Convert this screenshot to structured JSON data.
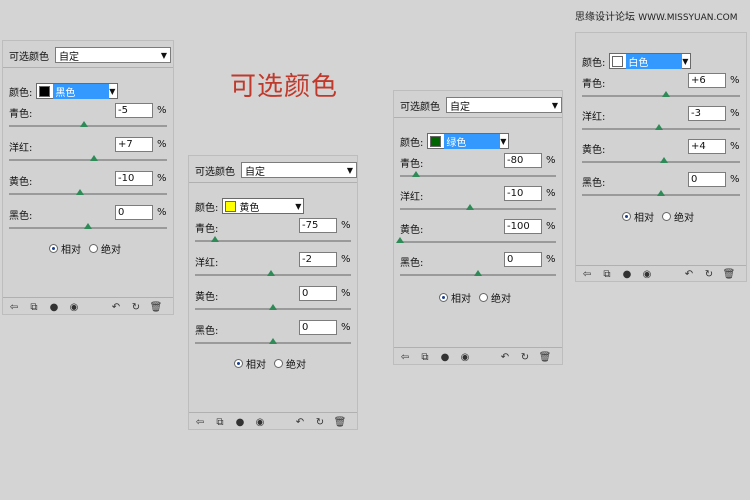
{
  "watermark": {
    "text": "思缘设计论坛",
    "site": "WWW.MISSYUAN.COM"
  },
  "big_title": "可选颜色",
  "common": {
    "header_label": "可选颜色",
    "preset": "自定",
    "color_label": "颜色:",
    "pct": "%",
    "mode_relative": "相对",
    "mode_absolute": "绝对"
  },
  "panels": [
    {
      "id": "black",
      "color": {
        "name": "黑色",
        "swatch": "#000000",
        "selected": true
      },
      "sliders": [
        {
          "label": "青色:",
          "value": "-5",
          "fraction": 0.475
        },
        {
          "label": "洋红:",
          "value": "+7",
          "fraction": 0.535
        },
        {
          "label": "黄色:",
          "value": "-10",
          "fraction": 0.45
        },
        {
          "label": "黑色:",
          "value": "0",
          "fraction": 0.5
        }
      ],
      "mode": "relative"
    },
    {
      "id": "yellow",
      "color": {
        "name": "黄色",
        "swatch": "#ffff00",
        "selected": false
      },
      "sliders": [
        {
          "label": "青色:",
          "value": "-75",
          "fraction": 0.125
        },
        {
          "label": "洋红:",
          "value": "-2",
          "fraction": 0.49
        },
        {
          "label": "黄色:",
          "value": "0",
          "fraction": 0.5
        },
        {
          "label": "黑色:",
          "value": "0",
          "fraction": 0.5
        }
      ],
      "mode": "relative"
    },
    {
      "id": "green",
      "color": {
        "name": "绿色",
        "swatch": "#006400",
        "selected": true
      },
      "sliders": [
        {
          "label": "青色:",
          "value": "-80",
          "fraction": 0.1
        },
        {
          "label": "洋红:",
          "value": "-10",
          "fraction": 0.45
        },
        {
          "label": "黄色:",
          "value": "-100",
          "fraction": 0.0
        },
        {
          "label": "黑色:",
          "value": "0",
          "fraction": 0.5
        }
      ],
      "mode": "relative"
    },
    {
      "id": "white",
      "color": {
        "name": "白色",
        "swatch": "#ffffff",
        "selected": true
      },
      "sliders": [
        {
          "label": "青色:",
          "value": "+6",
          "fraction": 0.53
        },
        {
          "label": "洋红:",
          "value": "-3",
          "fraction": 0.485
        },
        {
          "label": "黄色:",
          "value": "+4",
          "fraction": 0.52
        },
        {
          "label": "黑色:",
          "value": "0",
          "fraction": 0.5
        }
      ],
      "mode": "relative"
    }
  ],
  "toolbar_icons": [
    "back-arrow-icon",
    "clip-layer-icon",
    "visibility-icon",
    "view-previous-icon",
    "reset-icon",
    "refresh-icon",
    "trash-icon"
  ]
}
